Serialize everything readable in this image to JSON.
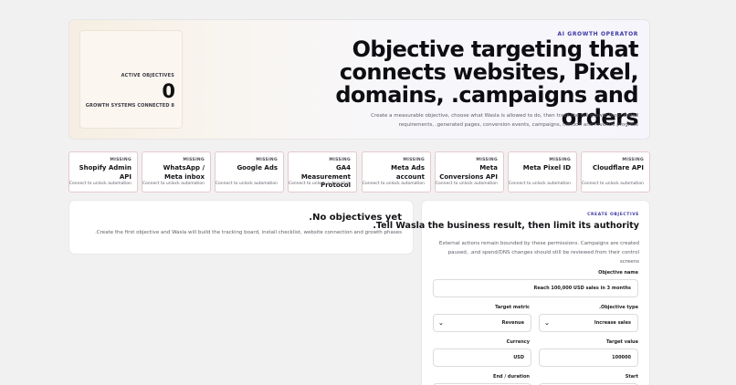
{
  "hero": {
    "eyebrow": "AI GROWTH OPERATOR",
    "title": "Objective targeting that connects websites, Pixel, domains, .campaigns and orders",
    "subtitle": "Create a measurable objective, choose what Wasla is allowed to do, then track the full growth loop: install requirements, .generated pages, conversion events, campaigns, handoff and revenue progress",
    "active_objectives_label": "ACTIVE OBJECTIVES",
    "active_objectives_value": "0",
    "growth_systems_label": "GROWTH SYSTEMS CONNECTED 8"
  },
  "connections": [
    {
      "status": "MISSING",
      "name": "Shopify Admin API",
      "note": "Connect to unlock automation"
    },
    {
      "status": "MISSING",
      "name": "WhatsApp / Meta inbox",
      "note": "Connect to unlock automation"
    },
    {
      "status": "MISSING",
      "name": "Google Ads",
      "note": "Connect to unlock automation"
    },
    {
      "status": "MISSING",
      "name": "GA4 Measurement Protocol",
      "note": "Connect to unlock automation"
    },
    {
      "status": "MISSING",
      "name": "Meta Ads account",
      "note": "Connect to unlock automation"
    },
    {
      "status": "MISSING",
      "name": "Meta Conversions API",
      "note": "Connect to unlock automation"
    },
    {
      "status": "MISSING",
      "name": "Meta Pixel ID",
      "note": "Connect to unlock automation"
    },
    {
      "status": "MISSING",
      "name": "Cloudflare API",
      "note": "Connect to unlock automation"
    }
  ],
  "empty_state": {
    "title": ".No objectives yet",
    "subtitle": ".Create the first objective and Wasla will build the tracking board, install checklist, website connection and growth phases"
  },
  "form": {
    "eyebrow": "CREATE OBJECTIVE",
    "title": ".Tell Wasla the business result, then limit its authority",
    "subtitle": "External actions remain bounded by these permissions. Campaigns are created paused, .and spend/DNS changes should still be reviewed from their control screens",
    "objective_name_label": "Objective name",
    "objective_name_value": "Reach 100,000 USD sales in 3 months",
    "target_metric_label": "Target metric",
    "target_metric_value": "Revenue",
    "objective_type_label": ".Objective type",
    "objective_type_value": "Increase sales",
    "currency_label": "Currency",
    "currency_value": "USD",
    "target_value_label": "Target value",
    "target_value_value": "100000",
    "end_label": "End / duration",
    "start_label": "Start"
  },
  "colors": {
    "accent": "#3d38a3",
    "missing_border": "#e6c9cb",
    "background": "#f1f1f2"
  }
}
